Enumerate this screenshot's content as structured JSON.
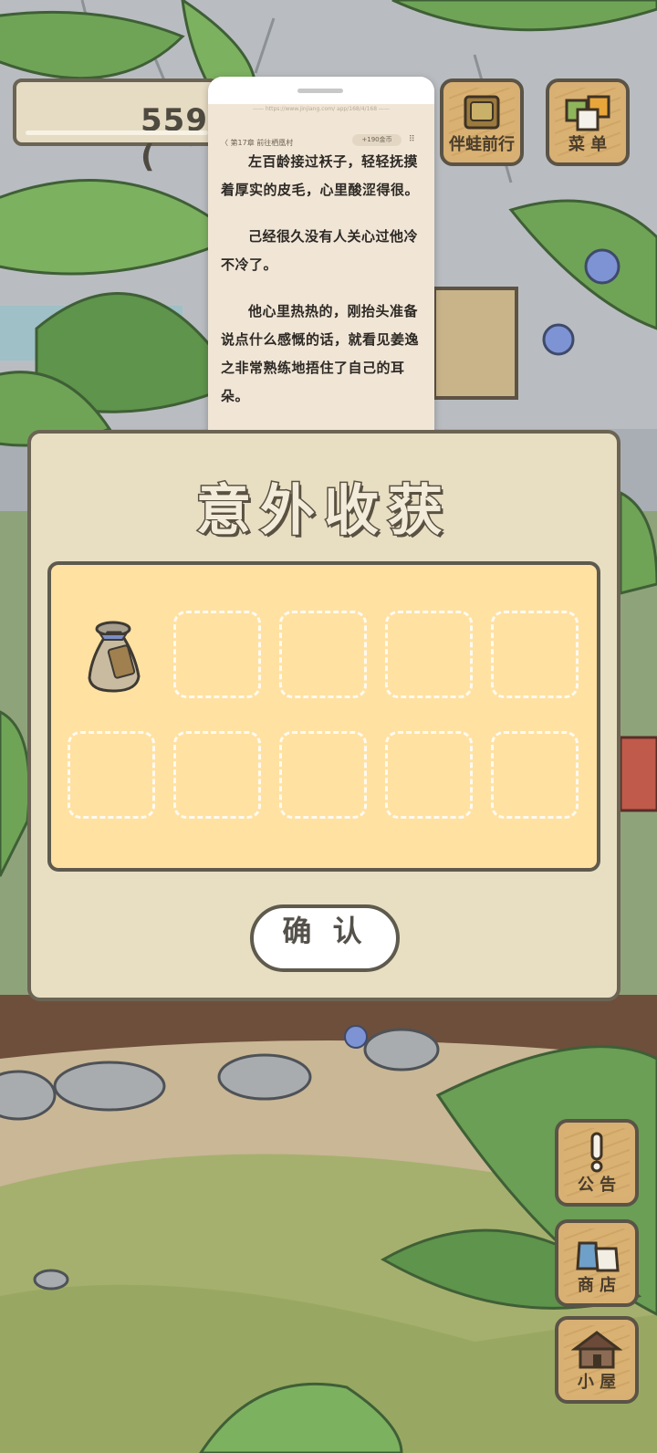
{
  "hud": {
    "coins": "559 ("
  },
  "buttons": {
    "travel_label": "伴蛙前行",
    "menu_label": "菜 单",
    "notice_label": "公 告",
    "shop_label": "商 店",
    "house_label": "小 屋"
  },
  "reader": {
    "url": "—— https://www.jinjiang.com/ app/168/4/168 ——",
    "breadcrumb": "〈 第17章 前往栖凰村",
    "coin_pill": "+190金币",
    "more": "⠿",
    "paragraphs": [
      "左百龄接过袄子，轻轻抚摸着厚实的皮毛，心里酸涩得很。",
      "己经很久没有人关心过他冷不冷了。",
      "他心里热热的，刚抬头准备说点什么感慨的话，就看见姜逸之非常熟练地捂住了自己的耳朵。"
    ]
  },
  "dialog": {
    "title": "意外收获",
    "confirm_label": "确 认",
    "slots_total": 10,
    "slots_filled": 1,
    "item_name": "bag-of-seeds-icon"
  }
}
